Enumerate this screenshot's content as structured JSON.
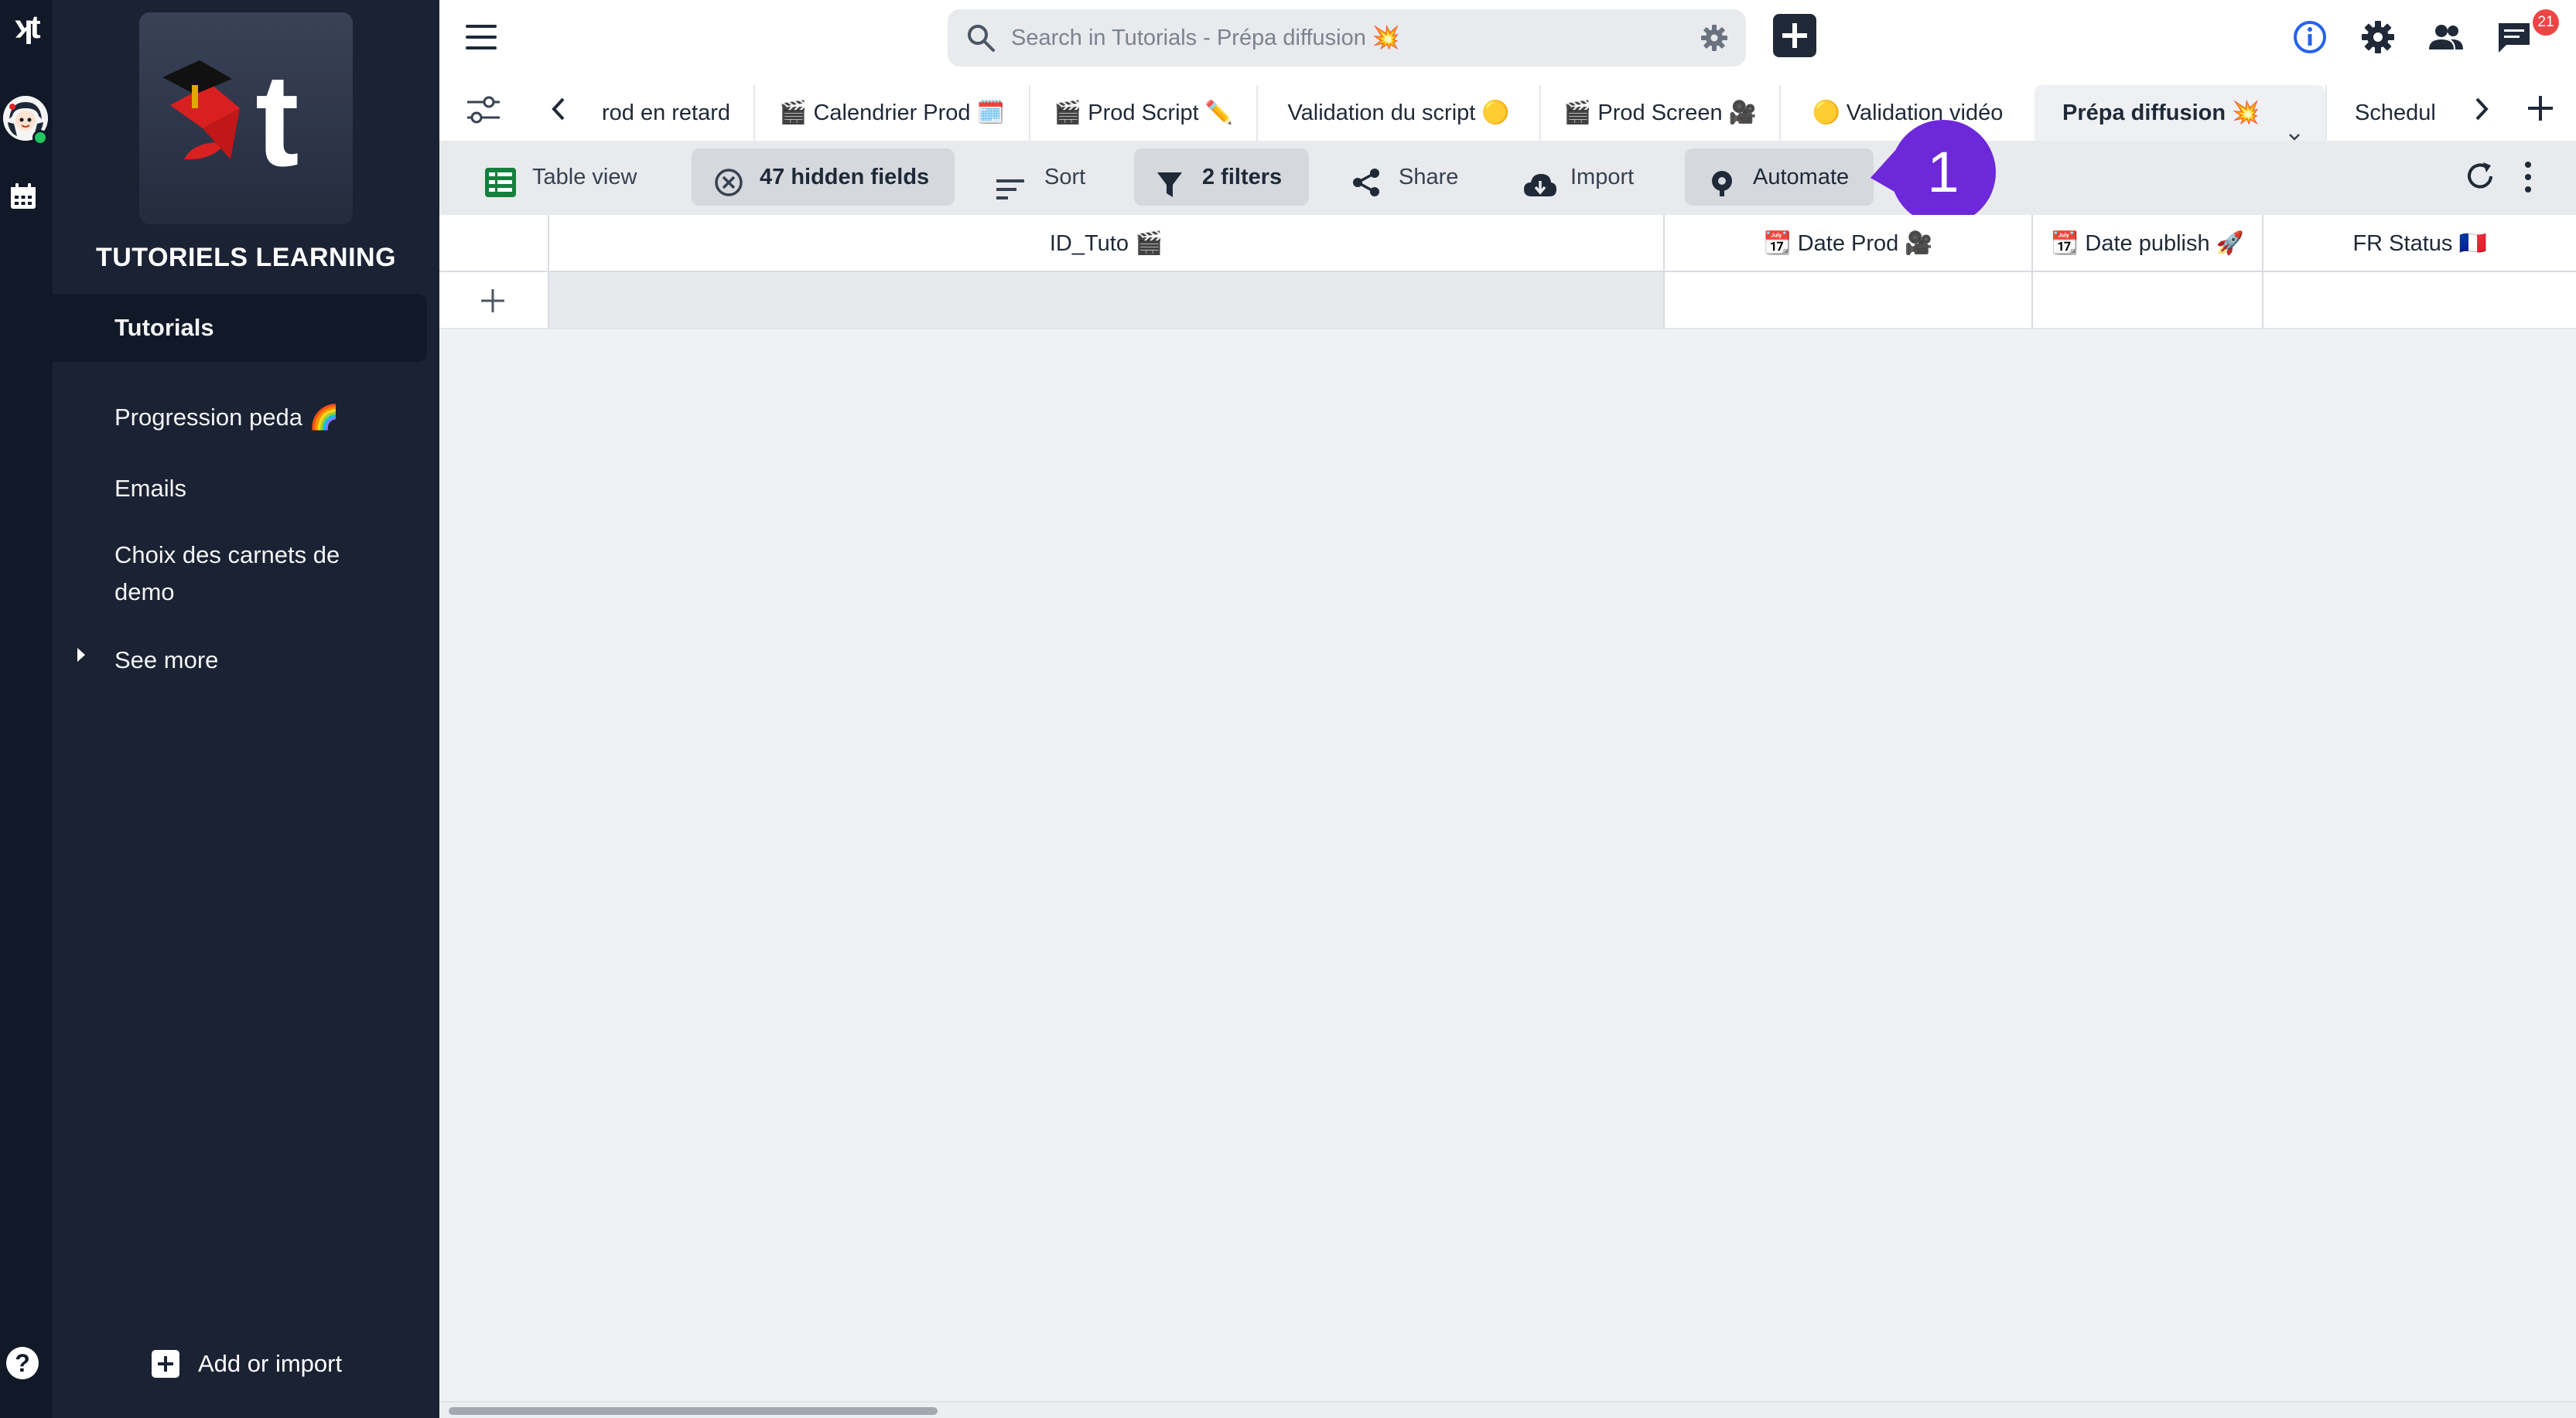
{
  "app": {
    "workspace_name": "TUTORIELS LEARNING",
    "rail_logo_text": "ʞt"
  },
  "sidebar": {
    "items": [
      {
        "label": "Tutorials",
        "active": true
      },
      {
        "label": "Progression peda 🌈",
        "active": false
      },
      {
        "label": "Emails",
        "active": false
      },
      {
        "label": "Choix des carnets de demo",
        "active": false
      },
      {
        "label": "See more",
        "active": false
      }
    ],
    "add_import_label": "Add or import"
  },
  "search": {
    "placeholder": "Search in Tutorials - Prépa diffusion 💥"
  },
  "topbar": {
    "notification_count": "21",
    "icons": [
      "menu-icon",
      "search-icon",
      "gear-icon",
      "plus-icon",
      "info-icon",
      "gear-icon",
      "users-icon",
      "chat-icon"
    ]
  },
  "tabs": [
    {
      "label": "rod en retard",
      "active": false
    },
    {
      "label": "🎬 Calendrier Prod 🗓️",
      "active": false
    },
    {
      "label": "🎬 Prod Script ✏️",
      "active": false
    },
    {
      "label": "Validation du script 🟡",
      "active": false
    },
    {
      "label": "🎬 Prod Screen 🎥",
      "active": false
    },
    {
      "label": "🟡 Validation vidéo",
      "active": false
    },
    {
      "label": "Prépa diffusion 💥",
      "active": true
    },
    {
      "label": "Schedul",
      "active": false
    }
  ],
  "toolbar": {
    "table_view": "Table view",
    "hidden_fields": "47 hidden fields",
    "sort": "Sort",
    "filters": "2 filters",
    "share": "Share",
    "import": "Import",
    "automate": "Automate"
  },
  "step_marker": "1",
  "grid": {
    "columns": [
      "ID_Tuto 🎬",
      "📆 Date Prod 🎥",
      "📆 Date publish 🚀",
      "FR Status 🇫🇷"
    ]
  },
  "colors": {
    "sidebar_bg": "#1a2233",
    "rail_bg": "#111827",
    "accent_marker": "#6d28d9",
    "table_view_icon": "#15803d",
    "info_icon": "#2563eb",
    "badge": "#ef4444"
  }
}
